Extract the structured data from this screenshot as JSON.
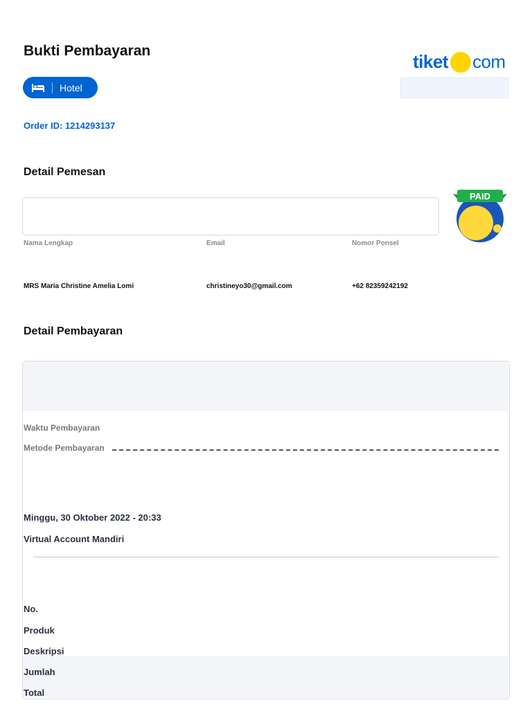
{
  "header": {
    "title": "Bukti Pembayaran",
    "logo_text": "tiket",
    "logo_suffix": "com",
    "category_label": "Hotel",
    "category_icon": "bed-icon",
    "order_id": "Order ID: 1214293137"
  },
  "pemesan": {
    "title": "Detail Pemesan",
    "badge": "PAID",
    "fields": [
      {
        "label": "Nama Lengkap",
        "value": "MRS Maria Christine Amelia Lomi"
      },
      {
        "label": "Email",
        "value": "christineyo30@gmail.com"
      },
      {
        "label": "Nomor Ponsel",
        "value": "+62 82359242192"
      }
    ]
  },
  "pembayaran": {
    "title": "Detail Pembayaran",
    "labels": [
      "Waktu Pembayaran",
      "Metode Pembayaran"
    ],
    "values": [
      "Minggu, 30 Oktober 2022 - 20:33",
      "Virtual Account Mandiri"
    ],
    "columns": [
      "No.",
      "Produk",
      "Deskripsi",
      "Jumlah",
      "Total"
    ]
  },
  "colors": {
    "brand": "#0064d2",
    "logo_dot": "#ffd400"
  }
}
